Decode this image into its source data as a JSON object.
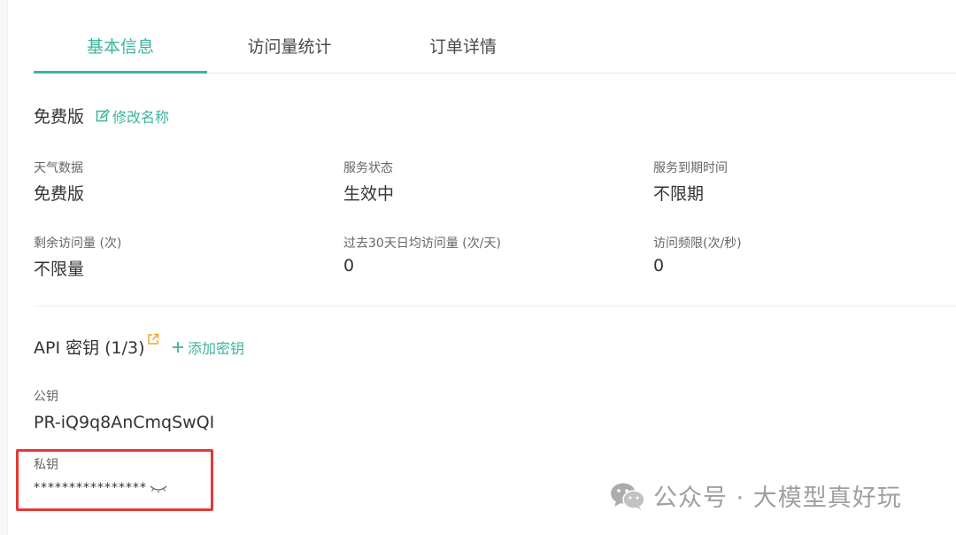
{
  "tabs": [
    {
      "label": "基本信息",
      "active": true
    },
    {
      "label": "访问量统计",
      "active": false
    },
    {
      "label": "订单详情",
      "active": false
    }
  ],
  "plan": {
    "title": "免费版",
    "rename_label": "修改名称"
  },
  "info": [
    {
      "label": "天气数据",
      "value": "免费版"
    },
    {
      "label": "服务状态",
      "value": "生效中"
    },
    {
      "label": "服务到期时间",
      "value": "不限期"
    },
    {
      "label": "剩余访问量 (次)",
      "value": "不限量"
    },
    {
      "label": "过去30天日均访问量 (次/天)",
      "value": "0"
    },
    {
      "label": "访问频限(次/秒)",
      "value": "0"
    }
  ],
  "api": {
    "title": "API 密钥 (1/3)",
    "add_label": "添加密钥",
    "public_key_label": "公钥",
    "public_key_value": "PR-iQ9q8AnCmqSwQI",
    "private_key_label": "私钥",
    "private_key_value": "****************"
  },
  "watermark": {
    "text": "公众号 · 大模型真好玩"
  },
  "colors": {
    "accent": "#3db39e",
    "highlight_box": "#e53935",
    "external_link_icon": "#f5a623"
  },
  "icons": [
    "edit-icon",
    "external-link-icon",
    "plus-icon",
    "eye-closed-icon",
    "wechat-icon"
  ]
}
